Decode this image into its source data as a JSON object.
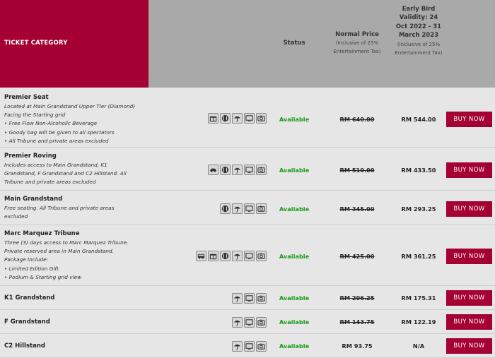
{
  "header": {
    "category_label": "TICKET CATEGORY",
    "status_label": "Status",
    "normal_price_label": "Normal Price",
    "normal_price_sub": "(Inclusive of 25% Entertainment Tax)",
    "early_bird_label": "Early Bird Validity: 24 Oct 2022 - 31 March 2023",
    "early_bird_sub": "(Inclusive of 25% Entertainment Tax)",
    "colors": {
      "accent": "#a50034",
      "header_bg": "#a9a9a9",
      "available": "#1a9a1a"
    }
  },
  "tickets": [
    {
      "title": "Premier Seat",
      "description": [
        "Located at Main Grandstand Upper Tier (Diamond)",
        "Facing the Starting grid",
        "• Free Flow Non-Alcoholic Beverage",
        "• Goody bag will be given to all spectators",
        "• All Tribune and private areas excluded"
      ],
      "icons": [
        "gift-icon",
        "food-icon",
        "umbrella-icon",
        "screen-icon",
        "camera-icon"
      ],
      "status": "Available",
      "normal_price": "RM 640.00",
      "early_price": "RM 544.00",
      "buy_label": "BUY NOW"
    },
    {
      "title": "Premier Roving",
      "description": [
        "Includes access to Main Grandstand, K1",
        "Grandstand, F Grandstand and C2 Hillstand. All",
        "Tribune and private areas excluded"
      ],
      "icons": [
        "car-icon",
        "food-icon",
        "umbrella-icon",
        "screen-icon",
        "camera-icon"
      ],
      "status": "Available",
      "normal_price": "RM 510.00",
      "early_price": "RM 433.50",
      "buy_label": "BUY NOW"
    },
    {
      "title": "Main Grandstand",
      "description": [
        "Free seating. All Tribune and private areas",
        "excluded"
      ],
      "icons": [
        "food-icon",
        "umbrella-icon",
        "screen-icon",
        "camera-icon"
      ],
      "status": "Available",
      "normal_price": "RM 345.00",
      "early_price": "RM 293.25",
      "buy_label": "BUY NOW"
    },
    {
      "title": "Marc Marquez Tribune",
      "description": [
        "Three (3) days access to Marc Marquez Tribune.",
        "Private reserved area in Main Grandstand.",
        "Package Include:",
        "• Limited Edition Gift",
        "• Podium & Starting grid view"
      ],
      "icons": [
        "bus-icon",
        "gift-icon",
        "food-icon",
        "umbrella-icon",
        "screen-icon",
        "camera-icon"
      ],
      "status": "Available",
      "normal_price": "RM 425.00",
      "early_price": "RM 361.25",
      "buy_label": "BUY NOW"
    },
    {
      "title": "K1 Grandstand",
      "description": [],
      "icons": [
        "umbrella-icon",
        "screen-icon",
        "camera-icon"
      ],
      "status": "Available",
      "normal_price": "RM 206.25",
      "early_price": "RM 175.31",
      "buy_label": "BUY NOW"
    },
    {
      "title": "F Grandstand",
      "description": [],
      "icons": [
        "umbrella-icon",
        "screen-icon",
        "camera-icon"
      ],
      "status": "Available",
      "normal_price": "RM 143.75",
      "early_price": "RM 122.19",
      "buy_label": "BUY NOW"
    },
    {
      "title": "C2 Hillstand",
      "description": [],
      "icons": [
        "umbrella-icon",
        "screen-icon",
        "camera-icon"
      ],
      "status": "Available",
      "normal_price": "RM 93.75",
      "early_price": "N/A",
      "buy_label": "BUY NOW"
    }
  ]
}
